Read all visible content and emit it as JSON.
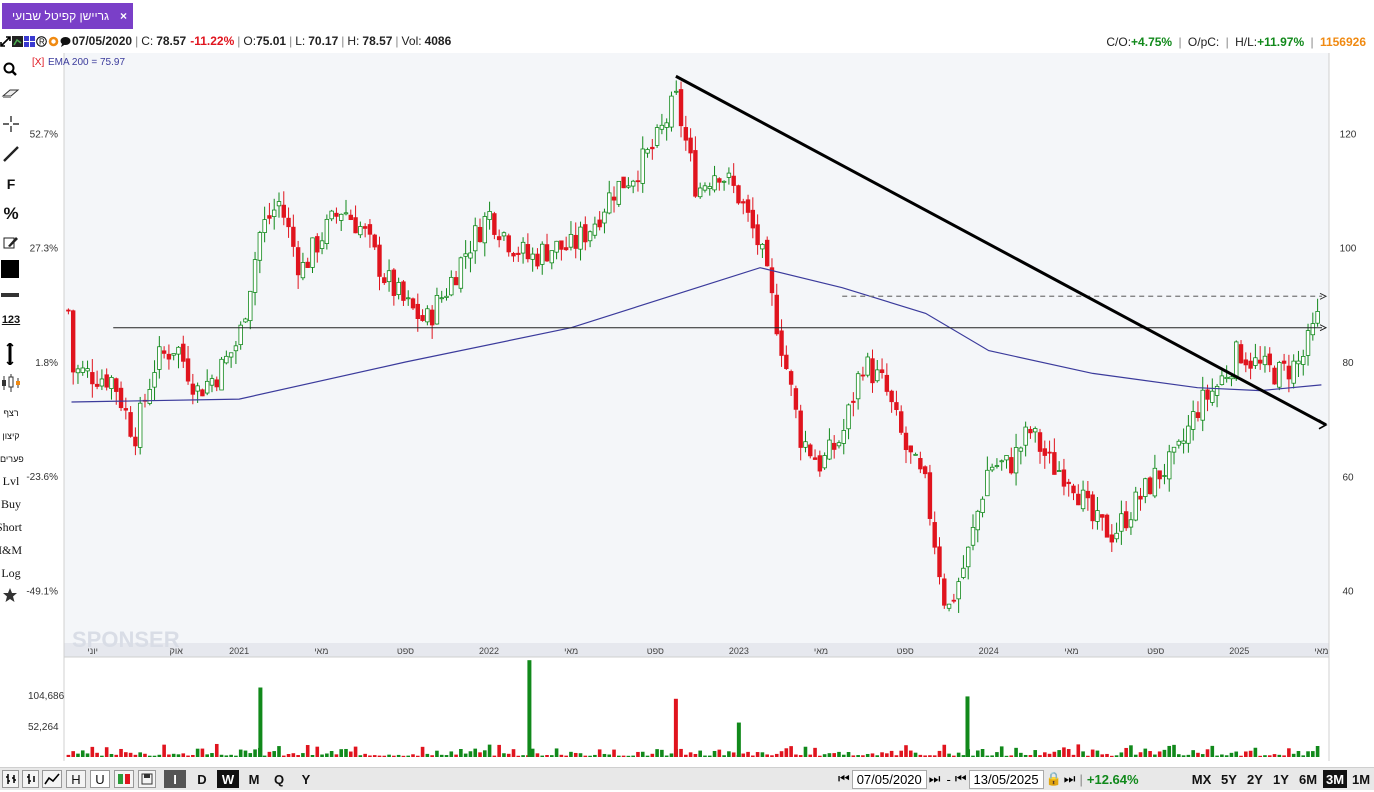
{
  "tab": {
    "title": "גריישן קפיטל שבועי",
    "close": "×"
  },
  "info": {
    "date": "07/05/2020",
    "close_label": "C:",
    "close": "78.57",
    "change": "-11.22%",
    "open_label": "O:",
    "open": "75.01",
    "low_label": "L:",
    "low": "70.17",
    "high_label": "H:",
    "high": "78.57",
    "vol_label": "Vol:",
    "vol": "4086",
    "co_label": "C/O:",
    "co": "+4.75%",
    "opc_label": "O/pC:",
    "hl_label": "H/L:",
    "hl": "+11.97%",
    "id": "1156926"
  },
  "toolbar": {
    "icons": [
      "search-icon",
      "eraser-icon",
      "crosshair-icon",
      "line-icon",
      "fibonacci-icon",
      "percent-icon",
      "edit-icon",
      "color-icon",
      "line-style-icon",
      "count-icon",
      "vertical-line-icon",
      "candles-icon"
    ],
    "f_label": "F",
    "pct_label": "%",
    "count_label": "123",
    "text_items": [
      "רצף",
      "קיצון",
      "פערים",
      "Lvl",
      "Buy",
      "Short",
      "M&M",
      "Log"
    ]
  },
  "indicator": {
    "remove": "[X]",
    "label": "EMA 200 = 75.97"
  },
  "watermark": "SPONSER",
  "chart_data": {
    "type": "candlestick",
    "instrument": "גריישן קפיטל שבועי",
    "period": "weekly",
    "x_range": [
      "2020-05",
      "2025-05"
    ],
    "x_ticks": [
      {
        "date": "2020-06",
        "label": "יוני"
      },
      {
        "date": "2020-10",
        "label": "אוק"
      },
      {
        "date": "2021-01",
        "label": "2021"
      },
      {
        "date": "2021-05",
        "label": "מאי"
      },
      {
        "date": "2021-09",
        "label": "ספט"
      },
      {
        "date": "2022-01",
        "label": "2022"
      },
      {
        "date": "2022-05",
        "label": "מאי"
      },
      {
        "date": "2022-09",
        "label": "ספט"
      },
      {
        "date": "2023-01",
        "label": "2023"
      },
      {
        "date": "2023-05",
        "label": "מאי"
      },
      {
        "date": "2023-09",
        "label": "ספט"
      },
      {
        "date": "2024-01",
        "label": "2024"
      },
      {
        "date": "2024-05",
        "label": "מאי"
      },
      {
        "date": "2024-09",
        "label": "ספט"
      },
      {
        "date": "2025-01",
        "label": "2025"
      },
      {
        "date": "2025-05",
        "label": "מאי"
      }
    ],
    "y_right_ticks": [
      40,
      60,
      80,
      100,
      120
    ],
    "y_left_ticks": [
      "52.7%",
      "27.3%",
      "1.8%",
      "-23.6%",
      "-49.1%"
    ],
    "ylim": [
      30,
      132
    ],
    "close_path": [
      [
        "2020-05",
        78.6
      ],
      [
        "2020-07",
        77
      ],
      [
        "2020-08",
        67
      ],
      [
        "2020-09",
        80
      ],
      [
        "2020-10",
        83
      ],
      [
        "2020-11",
        75
      ],
      [
        "2020-12",
        78
      ],
      [
        "2021-01",
        84
      ],
      [
        "2021-02",
        103
      ],
      [
        "2021-03",
        108
      ],
      [
        "2021-04",
        96
      ],
      [
        "2021-05",
        102
      ],
      [
        "2021-06",
        107
      ],
      [
        "2021-07",
        103
      ],
      [
        "2021-08",
        95
      ],
      [
        "2021-09",
        90
      ],
      [
        "2021-10",
        87
      ],
      [
        "2021-11",
        93
      ],
      [
        "2021-12",
        100
      ],
      [
        "2022-01",
        106
      ],
      [
        "2022-02",
        101
      ],
      [
        "2022-03",
        98
      ],
      [
        "2022-04",
        100
      ],
      [
        "2022-05",
        100
      ],
      [
        "2022-06",
        104
      ],
      [
        "2022-07",
        110
      ],
      [
        "2022-08",
        113
      ],
      [
        "2022-09",
        118
      ],
      [
        "2022-10",
        126
      ],
      [
        "2022-11",
        110
      ],
      [
        "2022-12",
        114
      ],
      [
        "2023-01",
        109
      ],
      [
        "2023-02",
        100
      ],
      [
        "2023-03",
        85
      ],
      [
        "2023-04",
        67
      ],
      [
        "2023-05",
        62
      ],
      [
        "2023-06",
        67
      ],
      [
        "2023-07",
        80
      ],
      [
        "2023-08",
        76
      ],
      [
        "2023-09",
        65
      ],
      [
        "2023-10",
        58
      ],
      [
        "2023-11",
        36
      ],
      [
        "2023-12",
        46
      ],
      [
        "2024-01",
        62
      ],
      [
        "2024-02",
        62
      ],
      [
        "2024-03",
        68
      ],
      [
        "2024-04",
        62
      ],
      [
        "2024-05",
        60
      ],
      [
        "2024-06",
        52
      ],
      [
        "2024-07",
        50
      ],
      [
        "2024-08",
        55
      ],
      [
        "2024-09",
        60
      ],
      [
        "2024-10",
        63
      ],
      [
        "2024-11",
        72
      ],
      [
        "2024-12",
        76
      ],
      [
        "2025-01",
        82
      ],
      [
        "2025-02",
        79
      ],
      [
        "2025-03",
        78
      ],
      [
        "2025-04",
        80
      ],
      [
        "2025-05",
        89
      ]
    ],
    "ema200": {
      "label": "EMA 200 = 75.97",
      "points": [
        [
          "2020-05",
          73
        ],
        [
          "2021-01",
          73.5
        ],
        [
          "2021-09",
          80
        ],
        [
          "2022-05",
          86
        ],
        [
          "2022-11",
          93
        ],
        [
          "2023-02",
          96.5
        ],
        [
          "2023-06",
          93
        ],
        [
          "2023-10",
          88.5
        ],
        [
          "2024-01",
          82
        ],
        [
          "2024-06",
          78
        ],
        [
          "2024-11",
          75.5
        ],
        [
          "2025-02",
          75
        ],
        [
          "2025-05",
          76
        ]
      ]
    },
    "trendline": {
      "from": [
        "2022-10",
        130
      ],
      "to": [
        "2025-05",
        69
      ]
    },
    "horizontal_line": {
      "value": 86,
      "from": "2020-07"
    },
    "dashed_line": {
      "value": 91.5,
      "from": "2023-06"
    },
    "volume": {
      "y_ticks": [
        "104,686",
        "52,264"
      ],
      "ylim": [
        0,
        165000
      ],
      "spikes": [
        {
          "date": "2021-02",
          "value": 117000,
          "color": "green"
        },
        {
          "date": "2022-03",
          "value": 163000,
          "color": "green"
        },
        {
          "date": "2022-10",
          "value": 98000,
          "color": "red"
        },
        {
          "date": "2023-01",
          "value": 58000,
          "color": "green"
        },
        {
          "date": "2023-12",
          "value": 102000,
          "color": "green"
        }
      ]
    },
    "colors": {
      "up": "#11891b",
      "down": "#e0141e",
      "ema": "#3b3b9c",
      "trend": "#000000"
    }
  },
  "bottombar": {
    "types": [
      "bars-icon",
      "ohlc-icon",
      "line-icon"
    ],
    "h_label": "H",
    "u_label": "U",
    "periods": [
      "D",
      "W",
      "M",
      "Q",
      "Y"
    ],
    "selected_period": "W",
    "from_date": "07/05/2020",
    "to_date": "13/05/2025",
    "range_change": "+12.64%",
    "ranges": [
      "MX",
      "5Y",
      "2Y",
      "1Y",
      "6M",
      "3M",
      "1M"
    ],
    "selected_range": "3M"
  }
}
